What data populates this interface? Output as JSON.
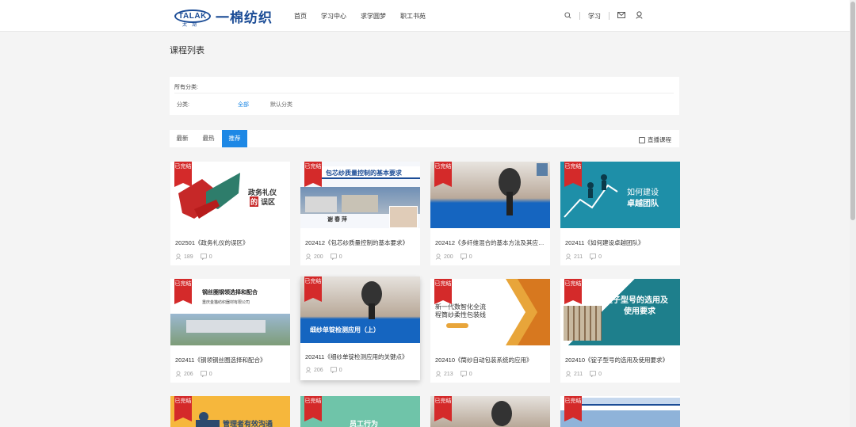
{
  "header": {
    "logo_mark": "TALAK",
    "logo_sub": "太湖",
    "brand": "一棉纺织",
    "nav": [
      "首页",
      "学习中心",
      "求学圆梦",
      "职工书苑"
    ],
    "study_label": "学习",
    "icons": [
      "search-icon",
      "mail-icon",
      "user-icon"
    ]
  },
  "page_title": "课程列表",
  "filter": {
    "all_label": "所有分类:",
    "category_label": "分类:",
    "options": [
      "全部",
      "默认分类"
    ],
    "selected": "全部"
  },
  "sort": {
    "tabs": [
      "最新",
      "最热",
      "推荐"
    ],
    "active": "推荐",
    "live_label": "直播课程",
    "live_checked": false
  },
  "badge_text": "已完结",
  "colors": {
    "accent": "#1e88e5",
    "badge": "#d42a2a",
    "brand": "#1b4c96"
  },
  "courses": [
    {
      "title": "202501《政务礼仪的误区》",
      "views": "189",
      "comments": "0",
      "thumb_text": [
        "政务礼仪",
        "的",
        "误区"
      ]
    },
    {
      "title": "202412《包芯纱质量控制的基本要求》",
      "views": "200",
      "comments": "0",
      "thumb_text": [
        "包芯纱质量控制的基本要求",
        "谢 春 萍"
      ]
    },
    {
      "title": "202412《多纤维混合的基本方法及其应用》",
      "views": "200",
      "comments": "0",
      "thumb_text": []
    },
    {
      "title": "202411《如何建设卓越团队》",
      "views": "211",
      "comments": "0",
      "thumb_text": [
        "如何建设",
        "卓越团队"
      ]
    },
    {
      "title": "202411《钢领钢丝圈选择和配合》",
      "views": "206",
      "comments": "0",
      "thumb_text": [
        "钢丝圈钢领选择和配合",
        "重庆金猫纺织器材有限公司"
      ]
    },
    {
      "title": "202411《细纱单锭检测应用的关键点》",
      "views": "206",
      "comments": "0",
      "thumb_text": [
        "细纱单锭检测应用（上）"
      ]
    },
    {
      "title": "202410《筒纱自动包装系统的应用》",
      "views": "213",
      "comments": "0",
      "thumb_text": [
        "新一代数智化全流",
        "程筒纱柔性包装线"
      ]
    },
    {
      "title": "202410《锭子型号的选用及使用要求》",
      "views": "211",
      "comments": "0",
      "thumb_text": [
        "锭子型号的选用及",
        "使用要求"
      ]
    },
    {
      "title": "",
      "views": "",
      "comments": "",
      "thumb_text": [
        "管理者有效沟通"
      ]
    },
    {
      "title": "",
      "views": "",
      "comments": "",
      "thumb_text": [
        "员工行为"
      ]
    },
    {
      "title": "",
      "views": "",
      "comments": "",
      "thumb_text": []
    },
    {
      "title": "",
      "views": "",
      "comments": "",
      "thumb_text": []
    }
  ]
}
